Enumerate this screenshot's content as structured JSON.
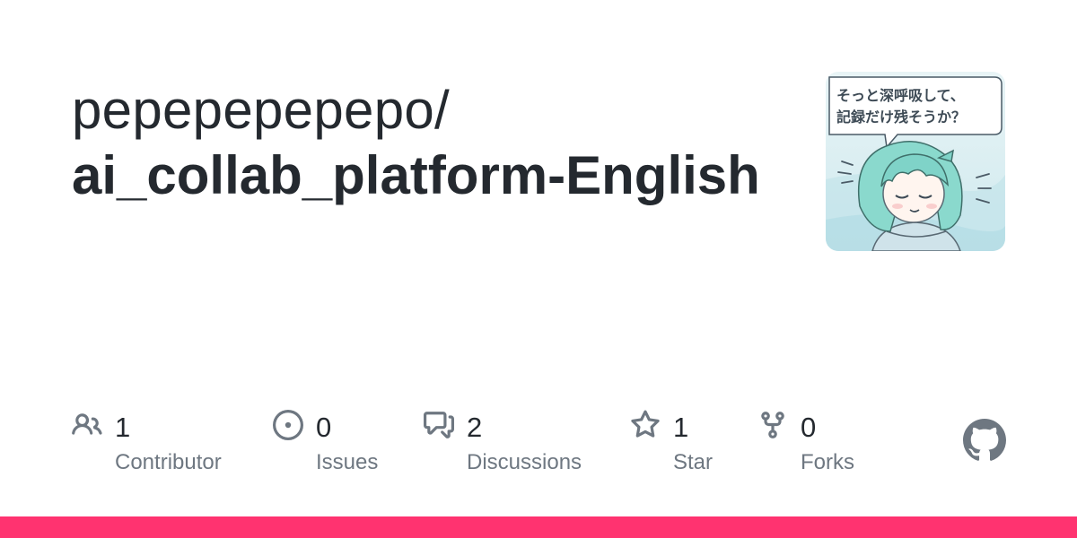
{
  "repo": {
    "owner": "pepepepepepo/",
    "name": "ai_collab_platform-English"
  },
  "avatar": {
    "caption_line1": "そっと深呼吸して、",
    "caption_line2": "記録だけ残そうか？"
  },
  "stats": [
    {
      "icon": "people-icon",
      "value": "1",
      "label": "Contributor"
    },
    {
      "icon": "issue-opened-icon",
      "value": "0",
      "label": "Issues"
    },
    {
      "icon": "discussions-icon",
      "value": "2",
      "label": "Discussions"
    },
    {
      "icon": "star-icon",
      "value": "1",
      "label": "Star"
    },
    {
      "icon": "repo-forked-icon",
      "value": "0",
      "label": "Forks"
    }
  ],
  "colors": {
    "title_text": "#24292f",
    "muted_text": "#6e7781",
    "icon": "#6e7781",
    "bottom_bar": "#ff3370",
    "avatar_bg": "#dff0f3",
    "avatar_hair": "#7fd3c8"
  }
}
